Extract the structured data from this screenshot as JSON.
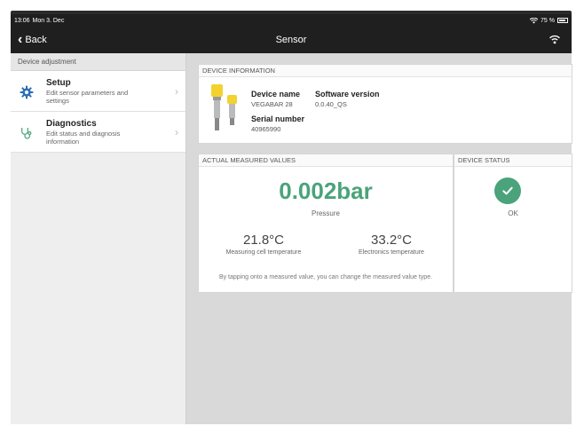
{
  "statusbar": {
    "time": "13:06",
    "date": "Mon 3. Dec",
    "battery": "75 %"
  },
  "nav": {
    "back_label": "Back",
    "title": "Sensor"
  },
  "sidebar": {
    "header": "Device adjustment",
    "items": [
      {
        "title": "Setup",
        "subtitle": "Edit sensor parameters and settings"
      },
      {
        "title": "Diagnostics",
        "subtitle": "Edit status and diagnosis information"
      }
    ]
  },
  "device_info": {
    "header": "DEVICE INFORMATION",
    "name_label": "Device name",
    "name_value": "VEGABAR 28",
    "software_label": "Software version",
    "software_value": "0.0.40_QS",
    "serial_label": "Serial number",
    "serial_value": "40965990"
  },
  "measured": {
    "header": "ACTUAL MEASURED VALUES",
    "primary_value": "0.002bar",
    "primary_label": "Pressure",
    "temp1_value": "21.8°C",
    "temp1_label": "Measuring cell temperature",
    "temp2_value": "33.2°C",
    "temp2_label": "Electronics temperature",
    "hint": "By tapping onto a measured value, you can change the measured value type."
  },
  "device_status": {
    "header": "DEVICE STATUS",
    "value": "OK"
  },
  "colors": {
    "accent_green": "#4aa37a",
    "nav_dark": "#1f1f1f",
    "icon_blue": "#2b6fb5"
  }
}
